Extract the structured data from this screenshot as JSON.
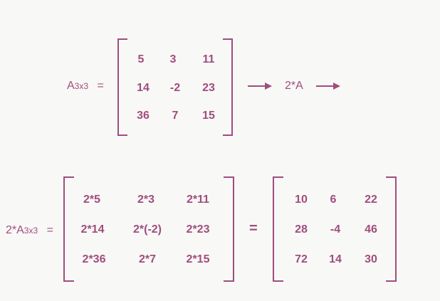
{
  "colors": {
    "accent": "#a04d7e",
    "background": "#f8f8f6"
  },
  "top": {
    "label_main": "A",
    "label_sub": "3x3",
    "label_eq": "=",
    "matrix": [
      [
        "5",
        "3",
        "11"
      ],
      [
        "14",
        "-2",
        "23"
      ],
      [
        "36",
        "7",
        "15"
      ]
    ],
    "operation": "2*A"
  },
  "bottom": {
    "label_main": "2*A",
    "label_sub": "3x3",
    "label_eq": "=",
    "expression_matrix": [
      [
        "2*5",
        "2*3",
        "2*11"
      ],
      [
        "2*14",
        "2*(-2)",
        "2*23"
      ],
      [
        "2*36",
        "2*7",
        "2*15"
      ]
    ],
    "equals": "=",
    "result_matrix": [
      [
        "10",
        "6",
        "22"
      ],
      [
        "28",
        "-4",
        "46"
      ],
      [
        "72",
        "14",
        "30"
      ]
    ]
  }
}
